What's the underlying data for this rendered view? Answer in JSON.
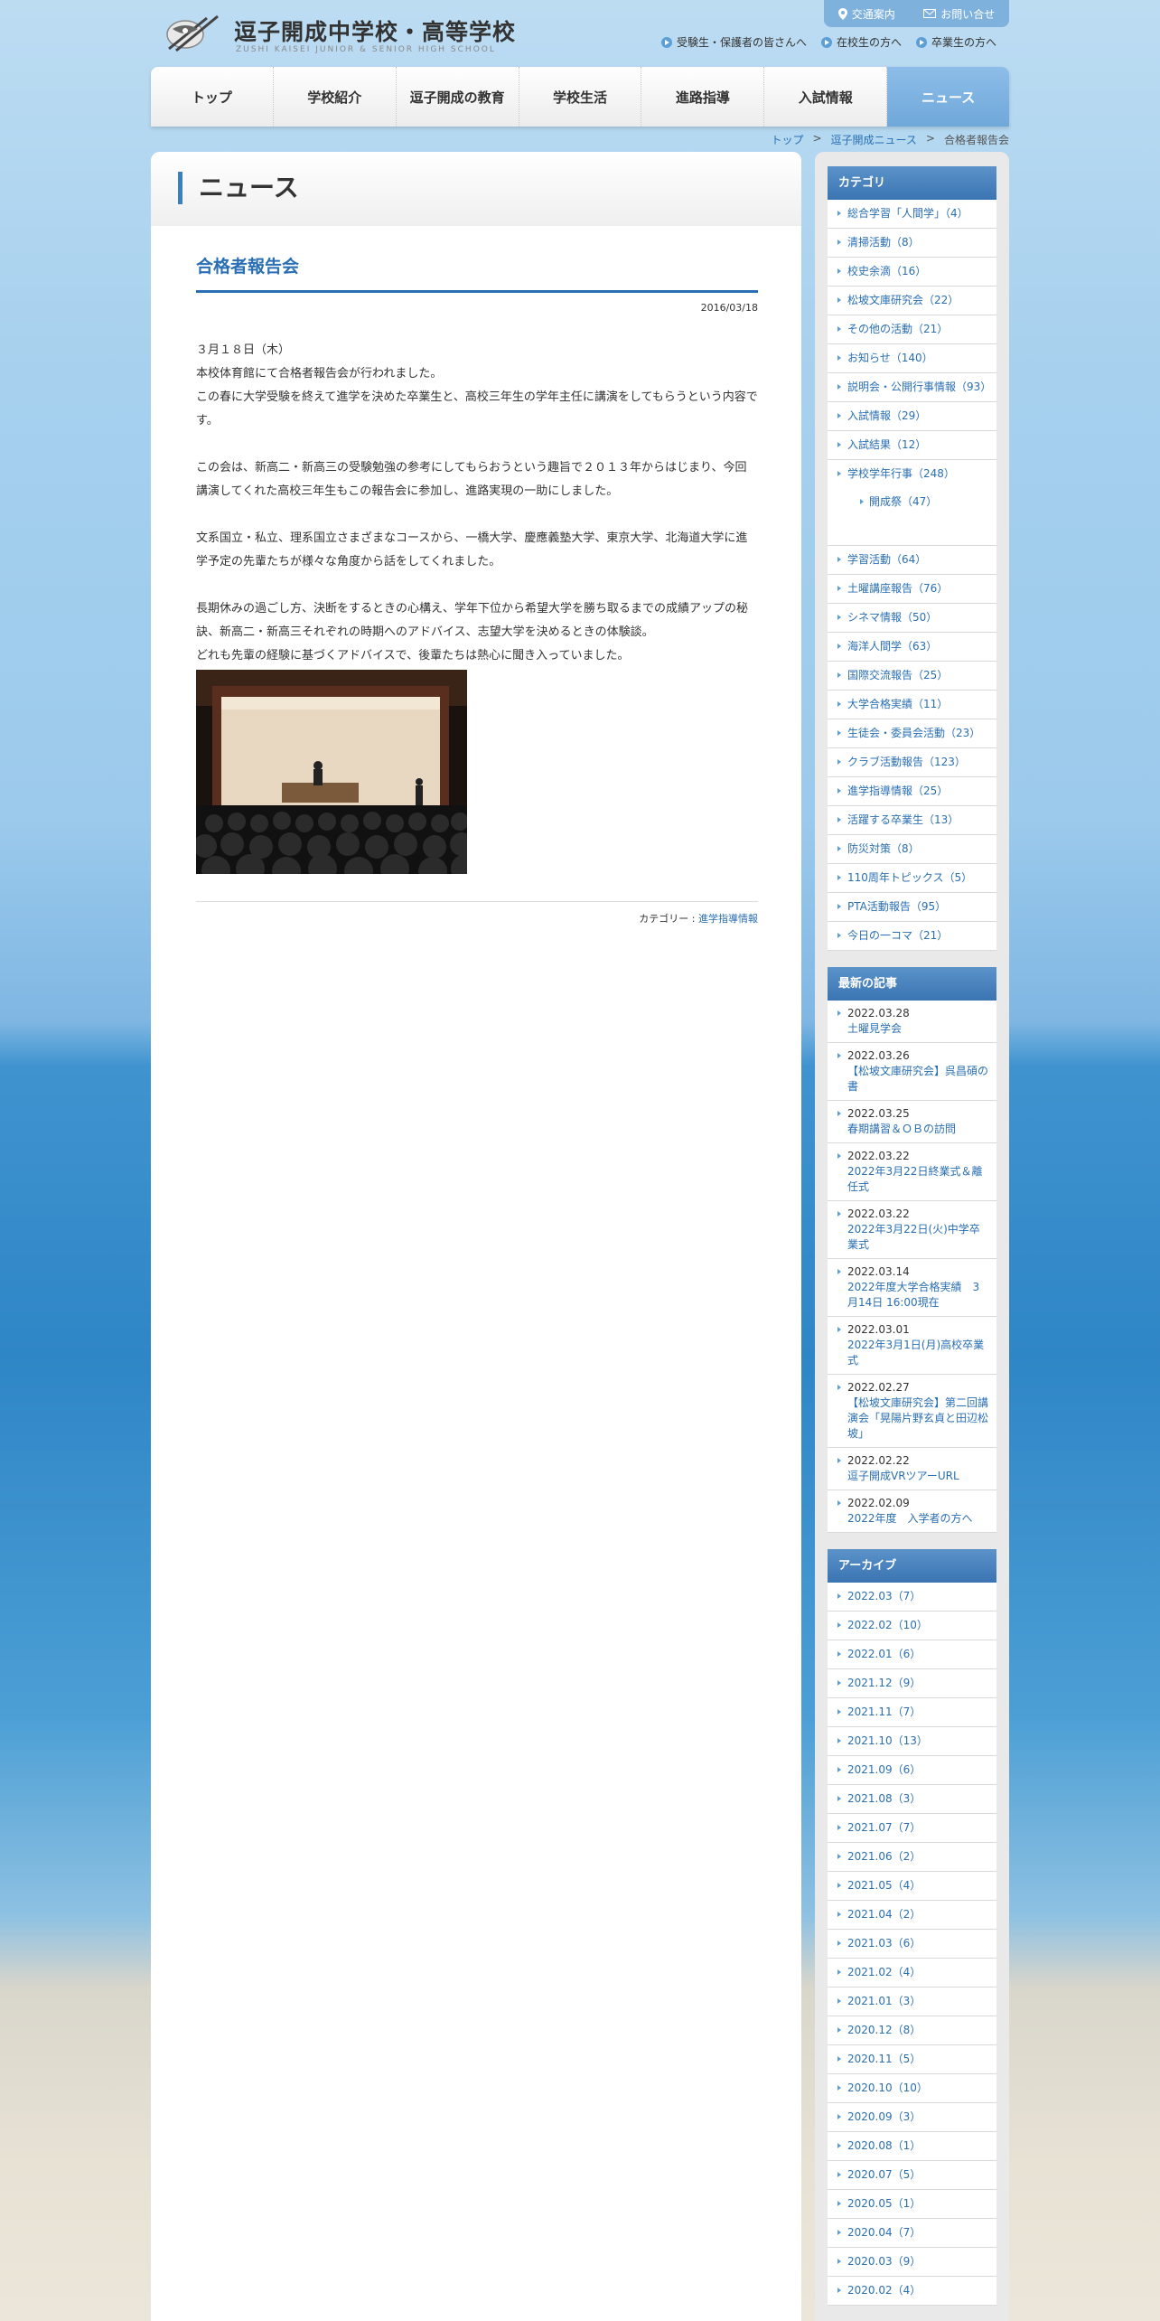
{
  "header": {
    "logo_jp": "逗子開成中学校・高等学校",
    "logo_en": "ZUSHI KAISEI JUNIOR & SENIOR HIGH SCHOOL",
    "top_links": [
      {
        "label": "交通案内",
        "icon": "map-pin-icon"
      },
      {
        "label": "お問い合せ",
        "icon": "mail-icon"
      }
    ],
    "sub_links": [
      "受験生・保護者の皆さんへ",
      "在校生の方へ",
      "卒業生の方へ"
    ],
    "nav": [
      "トップ",
      "学校紹介",
      "逗子開成の教育",
      "学校生活",
      "進路指導",
      "入試情報",
      "ニュース"
    ],
    "nav_active": "ニュース"
  },
  "breadcrumb": {
    "items": [
      "トップ",
      "逗子開成ニュース",
      "合格者報告会"
    ],
    "separator": ">"
  },
  "main": {
    "page_title": "ニュース",
    "article": {
      "title": "合格者報告会",
      "date": "2016/03/18",
      "paragraphs": [
        "３月１８日（木）",
        "本校体育館にて合格者報告会が行われました。",
        "この春に大学受験を終えて進学を決めた卒業生と、高校三年生の学年主任に講演をしてもらうという内容です。",
        "",
        "この会は、新高二・新高三の受験勉強の参考にしてもらおうという趣旨で２０１３年からはじまり、今回講演してくれた高校三年生もこの報告会に参加し、進路実現の一助にしました。",
        "",
        "文系国立・私立、理系国立さまざまなコースから、一橋大学、慶應義塾大学、東京大学、北海道大学に進学予定の先輩たちが様々な角度から話をしてくれました。",
        "",
        "長期休みの過ごし方、決断をするときの心構え、学年下位から希望大学を勝ち取るまでの成績アップの秘訣、新高二・新高三それぞれの時期へのアドバイス、志望大学を決めるときの体験談。",
        "どれも先輩の経験に基づくアドバイスで、後輩たちは熱心に聞き入っていました。"
      ],
      "category_label": "カテゴリー :",
      "category": "進学指導情報"
    }
  },
  "sidebar": {
    "categories": {
      "title": "カテゴリ",
      "items": [
        "総合学習「人間学」（4）",
        "清掃活動（8）",
        "校史余滴（16）",
        "松坡文庫研究会（22）",
        "その他の活動（21）",
        "お知らせ（140）",
        "説明会・公開行事情報（93）",
        "入試情報（29）",
        "入試結果（12）",
        "学校学年行事（248）",
        "学習活動（64）",
        "土曜講座報告（76）",
        "シネマ情報（50）",
        "海洋人間学（63）",
        "国際交流報告（25）",
        "大学合格実績（11）",
        "生徒会・委員会活動（23）",
        "クラブ活動報告（123）",
        "進学指導情報（25）",
        "活躍する卒業生（13）",
        "防災対策（8）",
        "110周年トピックス（5）",
        "PTA活動報告（95）",
        "今日の一コマ（21）"
      ],
      "sub_item": "開成祭（47）"
    },
    "recent": {
      "title": "最新の記事",
      "items": [
        {
          "date": "2022.03.28",
          "title": "土曜見学会"
        },
        {
          "date": "2022.03.26",
          "title": "【松坡文庫研究会】呉昌碩の書"
        },
        {
          "date": "2022.03.25",
          "title": "春期講習＆ＯＢの訪問"
        },
        {
          "date": "2022.03.22",
          "title": "2022年3月22日終業式＆離任式"
        },
        {
          "date": "2022.03.22",
          "title": "2022年3月22日(火)中学卒業式"
        },
        {
          "date": "2022.03.14",
          "title": "2022年度大学合格実績　3月14日 16:00現在"
        },
        {
          "date": "2022.03.01",
          "title": "2022年3月1日(月)高校卒業式"
        },
        {
          "date": "2022.02.27",
          "title": "【松坡文庫研究会】第二回講演会「晃陽片野玄貞と田辺松坡」"
        },
        {
          "date": "2022.02.22",
          "title": "逗子開成VRツアーURL"
        },
        {
          "date": "2022.02.09",
          "title": "2022年度　入学者の方へ"
        }
      ]
    },
    "archive": {
      "title": "アーカイブ",
      "items": [
        "2022.03（7）",
        "2022.02（10）",
        "2022.01（6）",
        "2021.12（9）",
        "2021.11（7）",
        "2021.10（13）",
        "2021.09（6）",
        "2021.08（3）",
        "2021.07（7）",
        "2021.06（2）",
        "2021.05（4）",
        "2021.04（2）",
        "2021.03（6）",
        "2021.02（4）",
        "2021.01（3）",
        "2020.12（8）",
        "2020.11（5）",
        "2020.10（10）",
        "2020.09（3）",
        "2020.08（1）",
        "2020.07（5）",
        "2020.05（1）",
        "2020.04（7）",
        "2020.03（9）",
        "2020.02（4）"
      ]
    }
  }
}
